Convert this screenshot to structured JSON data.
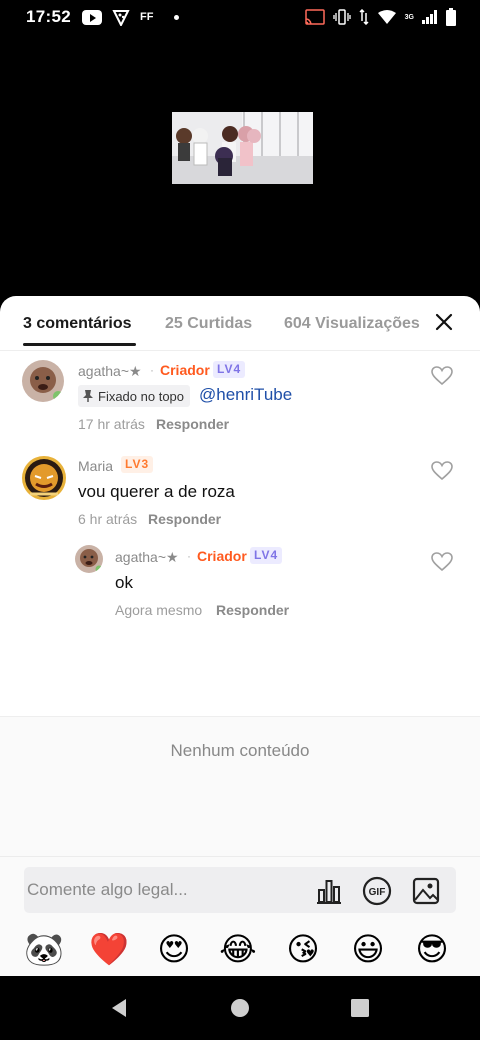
{
  "status_bar": {
    "time": "17:52",
    "ff_label": "FF",
    "network_label": "3G"
  },
  "tabs": {
    "comments": "3 comentários",
    "likes": "25 Curtidas",
    "views": "604 Visualizações"
  },
  "comments": [
    {
      "username": "agatha~★",
      "separator": "·",
      "creator_label": "Criador",
      "level": "LV4",
      "pinned_label": "Fixado no topo",
      "mention": "@henriTube",
      "time": "17 hr atrás",
      "reply_label": "Responder"
    },
    {
      "username": "Maria",
      "level": "LV3",
      "text": "vou querer a de roza",
      "time": "6 hr atrás",
      "reply_label": "Responder"
    },
    {
      "username": "agatha~★",
      "separator": "·",
      "creator_label": "Criador",
      "level": "LV4",
      "text": "ok",
      "time": "Agora mesmo",
      "reply_label": "Responder"
    }
  ],
  "empty_state": "Nenhum conteúdo",
  "input": {
    "placeholder": "Comente algo legal..."
  },
  "emojis": [
    "🐼",
    "❤️",
    "😍",
    "😂",
    "😘",
    "😃",
    "😎"
  ],
  "colors": {
    "creator": "#ff5a1f",
    "mention": "#1f4fa8",
    "lv4": "#7f74e6",
    "lv3": "#ff7a2f"
  }
}
